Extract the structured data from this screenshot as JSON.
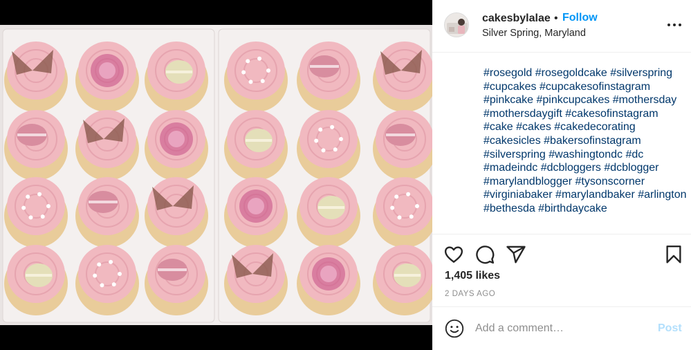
{
  "post": {
    "image_alt": "Box of pink cupcakes with roses, macarons and butterflies",
    "colors": {
      "frosting": "#f1b9c0",
      "frosting_dark": "#dc8f9d",
      "cake": "#e9cc9a",
      "macaron": "#d88d9f",
      "macaron_cream": "#e4dfb9",
      "butterfly": "#8b5a4e",
      "box": "#f4f0ef"
    }
  },
  "header": {
    "username": "cakesbylalae",
    "separator": "•",
    "follow_label": "Follow",
    "location": "Silver Spring, Maryland",
    "more_icon": "more-horizontal-icon"
  },
  "caption": {
    "text": "#rosegold #rosegoldcake #silverspring #cupcakes #cupcakesofinstagram #pinkcake #pinkcupcakes #mothersday #mothersdaygift #cakesofinstagram #cake #cakes #cakedecorating #cakesicles #bakersofinstagram #silverspring #washingtondc #dc #madeindc #dcbloggers #dcblogger #marylandblogger #tysonscorner #virginiabaker #marylandbaker #arlington #bethesda #birthdaycake"
  },
  "actions": {
    "icons": [
      "heart-icon",
      "comment-icon",
      "share-icon",
      "bookmark-icon"
    ]
  },
  "likes_text": "1,405 likes",
  "date_text": "2 DAYS AGO",
  "comment": {
    "emoji_icon": "emoji-icon",
    "placeholder": "Add a comment…",
    "post_label": "Post",
    "accent_color": "#0095f6",
    "post_disabled_color": "#b2dffc"
  }
}
